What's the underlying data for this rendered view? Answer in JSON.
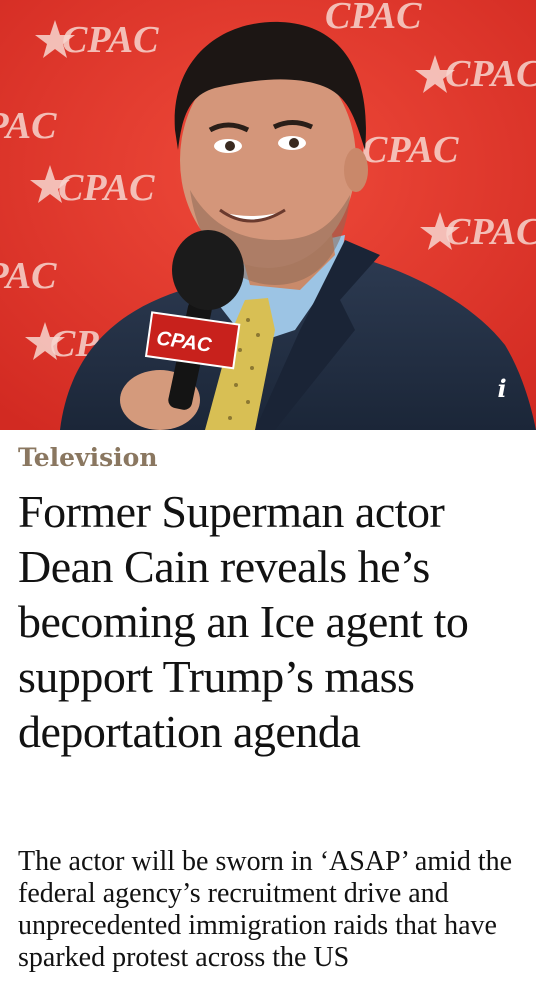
{
  "hero": {
    "alt": "Dean Cain speaking into a CPAC microphone",
    "backdrop_logo_text": "CPAC",
    "mic_flag_text": "CPAC",
    "info_icon_glyph": "i"
  },
  "article": {
    "kicker": "Television",
    "headline": "Former Superman actor Dean Cain reveals he’s becoming an Ice agent to support Trump’s mass deportation agenda",
    "standfirst": "The actor will be sworn in ‘ASAP’ amid the federal agency’s recruitment drive and unprecedented immigration raids that have sparked protest across the US"
  },
  "colors": {
    "backdrop_red": "#e4342b",
    "kicker": "#8a7760",
    "text": "#121212"
  }
}
